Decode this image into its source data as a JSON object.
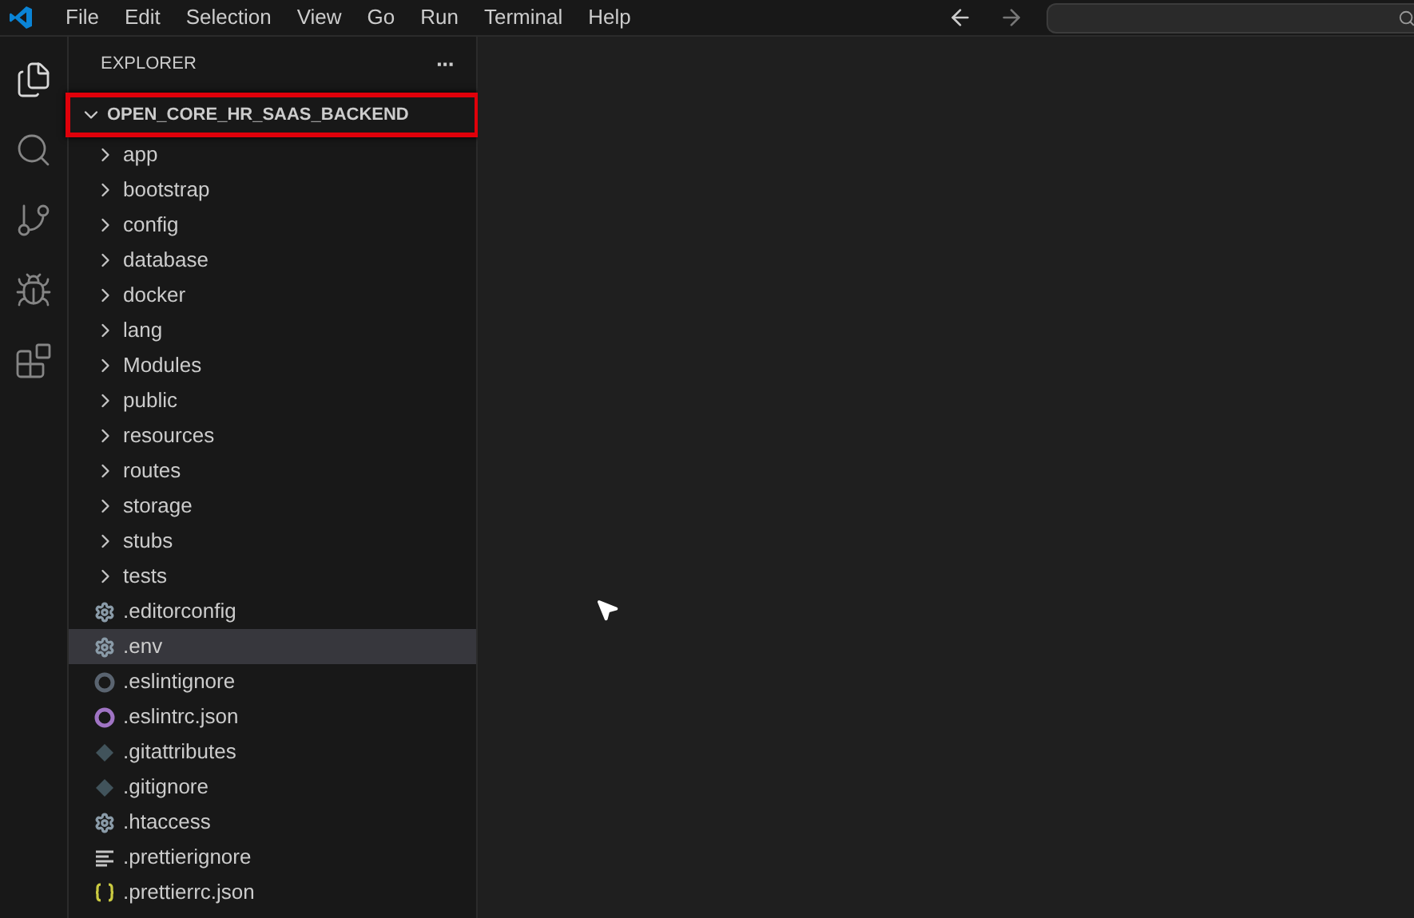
{
  "menu": [
    "File",
    "Edit",
    "Selection",
    "View",
    "Go",
    "Run",
    "Terminal",
    "Help"
  ],
  "activity_bar": [
    {
      "kind": "files",
      "selected": true
    },
    {
      "kind": "search",
      "selected": false
    },
    {
      "kind": "source-control",
      "selected": false
    },
    {
      "kind": "run-debug",
      "selected": false
    },
    {
      "kind": "extensions",
      "selected": false
    }
  ],
  "explorer": {
    "title": "EXPLORER",
    "more": "···",
    "root": {
      "label": "OPEN_CORE_HR_SAAS_BACKEND",
      "expanded": true,
      "highlighted": true
    },
    "items": [
      {
        "label": "app",
        "kind": "folder",
        "selected": false
      },
      {
        "label": "bootstrap",
        "kind": "folder",
        "selected": false
      },
      {
        "label": "config",
        "kind": "folder",
        "selected": false
      },
      {
        "label": "database",
        "kind": "folder",
        "selected": false
      },
      {
        "label": "docker",
        "kind": "folder",
        "selected": false
      },
      {
        "label": "lang",
        "kind": "folder",
        "selected": false
      },
      {
        "label": "Modules",
        "kind": "folder",
        "selected": false
      },
      {
        "label": "public",
        "kind": "folder",
        "selected": false
      },
      {
        "label": "resources",
        "kind": "folder",
        "selected": false
      },
      {
        "label": "routes",
        "kind": "folder",
        "selected": false
      },
      {
        "label": "storage",
        "kind": "folder",
        "selected": false
      },
      {
        "label": "stubs",
        "kind": "folder",
        "selected": false
      },
      {
        "label": "tests",
        "kind": "folder",
        "selected": false
      },
      {
        "label": ".editorconfig",
        "kind": "gear",
        "selected": false
      },
      {
        "label": ".env",
        "kind": "gear",
        "selected": true
      },
      {
        "label": ".eslintignore",
        "kind": "ring",
        "selected": false
      },
      {
        "label": ".eslintrc.json",
        "kind": "ring-purple",
        "selected": false
      },
      {
        "label": ".gitattributes",
        "kind": "git",
        "selected": false
      },
      {
        "label": ".gitignore",
        "kind": "git",
        "selected": false
      },
      {
        "label": ".htaccess",
        "kind": "gear",
        "selected": false
      },
      {
        "label": ".prettierignore",
        "kind": "lines",
        "selected": false
      },
      {
        "label": ".prettierrc.json",
        "kind": "braces",
        "selected": false
      }
    ]
  }
}
